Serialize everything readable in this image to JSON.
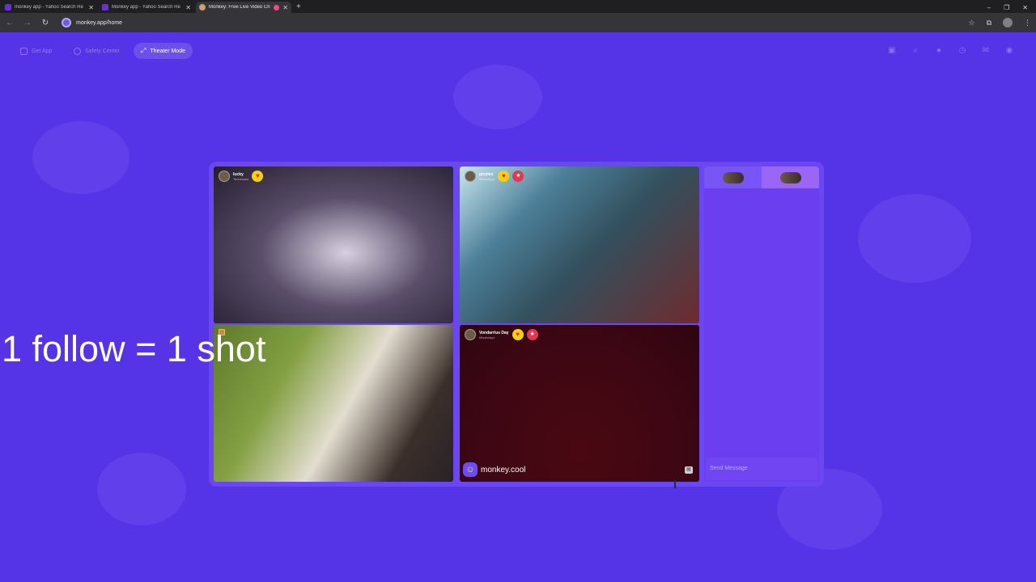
{
  "browser": {
    "tabs": [
      {
        "title": "monkey app - Yahoo Search Re",
        "active": false
      },
      {
        "title": "Monkey app - Yahoo Search Re",
        "active": false
      },
      {
        "title": "Monkey: Free Live Video Ch",
        "active": true
      }
    ],
    "new_tab": "+",
    "url": "monkey.app/home"
  },
  "nav": {
    "get_app": "Get App",
    "safety_center": "Safety Center",
    "theater_mode": "Theater Mode"
  },
  "participants": [
    {
      "name": "lucky",
      "location": "Tennessee"
    },
    {
      "name": "prezlee",
      "location": "Mississippi"
    },
    {
      "name": "",
      "location": ""
    },
    {
      "name": "Vondarrius Day",
      "location": "Mississippi"
    }
  ],
  "watermark": "monkey.cool",
  "chat": {
    "placeholder": "Send Message"
  },
  "overlay": {
    "caption": "1 follow = 1 shot"
  },
  "colors": {
    "page_bg": "#5533e6",
    "panel_bg": "#6a47f0",
    "accent_heart": "#f5d20a",
    "accent_flame": "#e1374f"
  }
}
